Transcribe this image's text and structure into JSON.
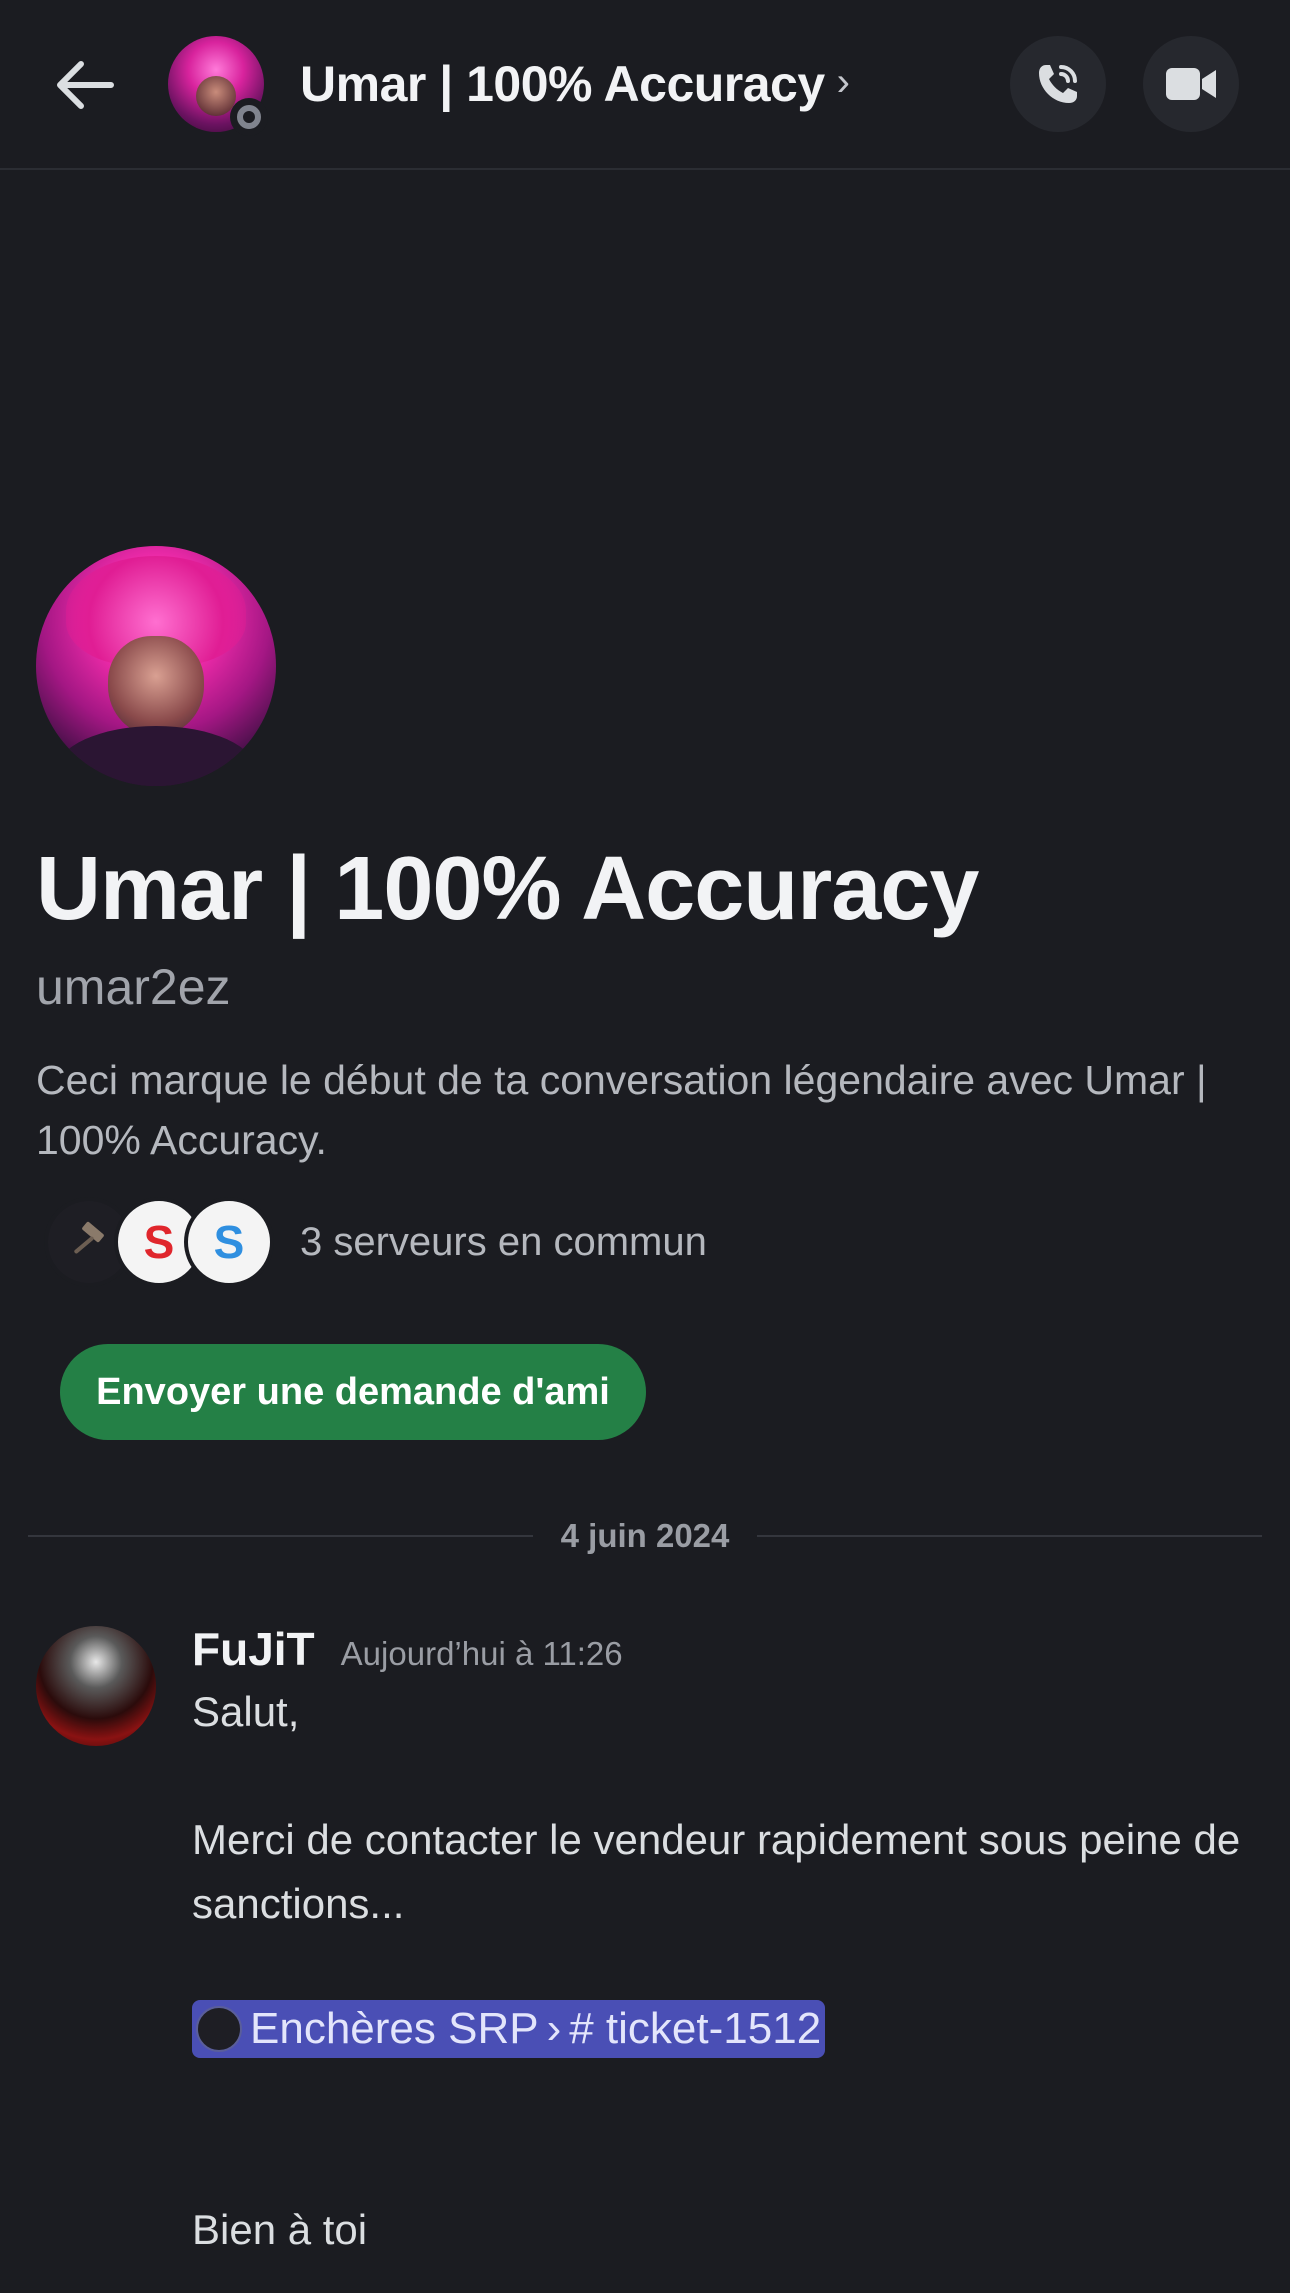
{
  "header": {
    "title": "Umar | 100% Accuracy",
    "chevron": "›",
    "back_icon": "arrow-left-icon",
    "call_icon": "phone-icon",
    "video_icon": "video-camera-icon",
    "status": "offline"
  },
  "profile": {
    "display_name": "Umar | 100% Accuracy",
    "username": "umar2ez",
    "intro": "Ceci marque le début de ta conversation légendaire avec Umar | 100% Accuracy.",
    "servers": {
      "icons": [
        "S",
        "S"
      ],
      "text": "3 serveurs en commun"
    },
    "friend_button": "Envoyer une demande d'ami"
  },
  "divider": {
    "date": "4 juin 2024"
  },
  "message": {
    "author": "FuJiT",
    "time": "Aujourd’hui à 11:26",
    "line1": "Salut,",
    "line2": "Merci de contacter le vendeur rapidement sous peine de sanctions...",
    "mention": {
      "server": "Enchères SRP",
      "separator": "›",
      "channel": "# ticket-1512"
    },
    "sign_off": "Bien à toi"
  },
  "colors": {
    "background": "#1b1c21",
    "friend_button": "#248046",
    "mention_bg": "#4a4fb5",
    "offline_status": "#80848e"
  }
}
